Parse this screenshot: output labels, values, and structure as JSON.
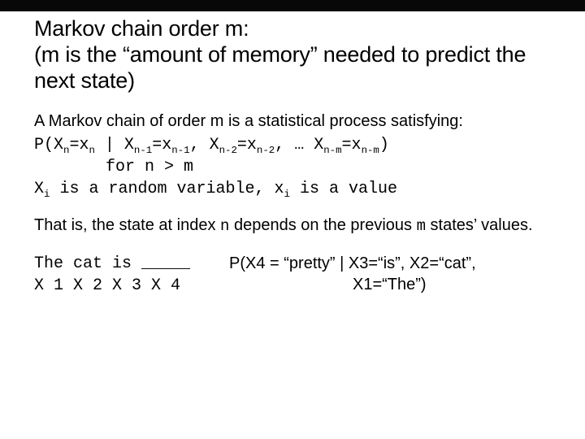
{
  "title": {
    "line1": "Markov chain order m:",
    "line2": "(m is the “amount of memory” needed to predict the next state)"
  },
  "p1": "A Markov chain of order m is a statistical process satisfying:",
  "eq": {
    "before": "P(X",
    "s1": "n",
    "t1": "=x",
    "s2": "n",
    "t2": " | X",
    "s3": "n-1",
    "t3": "=x",
    "s4": "n-1",
    "t4": ", X",
    "s5": "n-2",
    "t5": "=x",
    "s6": "n-2",
    "t6": ", … X",
    "s7": "n-m",
    "t7": "=x",
    "s8": "n-m",
    "t8": ")"
  },
  "for": "for n > m",
  "xi": {
    "a": "X",
    "a_sub": "i",
    "b": " is a random variable, x",
    "b_sub": "i",
    "c": " is a value"
  },
  "p2": {
    "a": "That is, the state at index ",
    "n": "n",
    "b": " depends on the previous ",
    "m": "m",
    "c": " states’ values."
  },
  "example": {
    "line1": "The cat is _____",
    "line2": "X 1  X 2  X 3 X 4"
  },
  "prob": {
    "l1": "P(X4 = “pretty” | X3=“is”, X2=“cat”,",
    "l2": "X1=“The”)"
  }
}
